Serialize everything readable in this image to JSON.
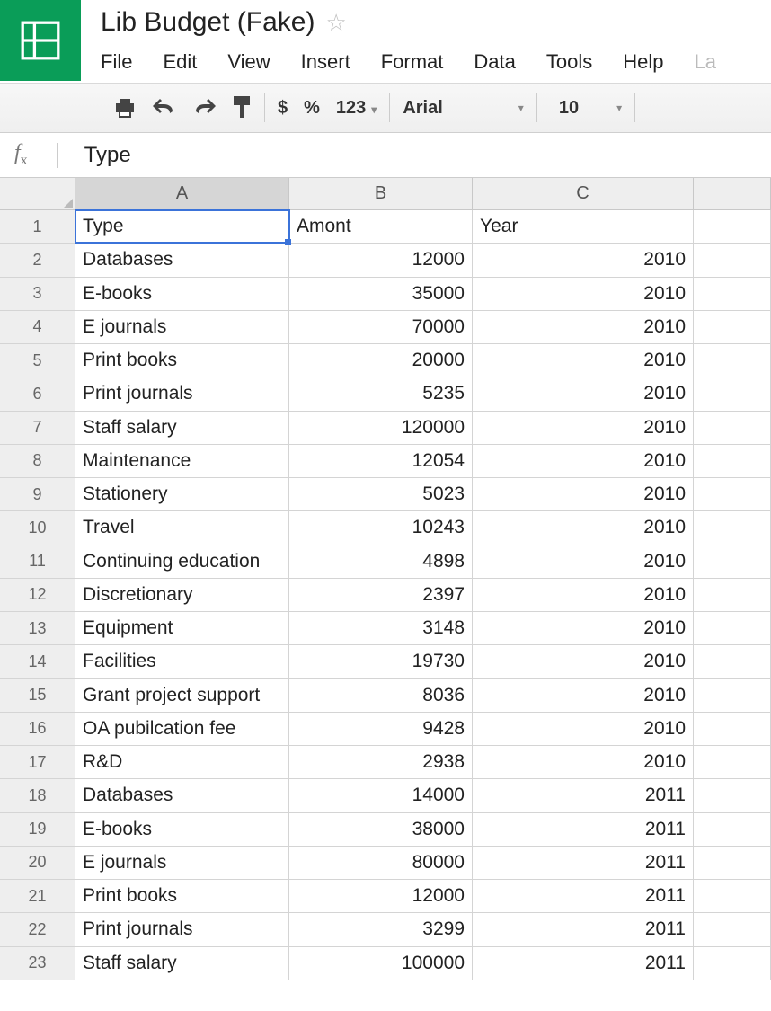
{
  "doc": {
    "title": "Lib Budget (Fake)"
  },
  "menu": {
    "file": "File",
    "edit": "Edit",
    "view": "View",
    "insert": "Insert",
    "format": "Format",
    "data": "Data",
    "tools": "Tools",
    "help": "Help",
    "last": "La"
  },
  "toolbar": {
    "dollar": "$",
    "percent": "%",
    "numfmt": "123",
    "font": "Arial",
    "size": "10"
  },
  "formula": {
    "label_f": "f",
    "label_x": "x",
    "value": "Type"
  },
  "columns": {
    "A": "A",
    "B": "B",
    "C": "C"
  },
  "header_row": {
    "A": "Type",
    "B": "Amont",
    "C": "Year"
  },
  "rows": [
    {
      "n": "2",
      "a": "Databases",
      "b": "12000",
      "c": "2010"
    },
    {
      "n": "3",
      "a": "E-books",
      "b": "35000",
      "c": "2010"
    },
    {
      "n": "4",
      "a": "E journals",
      "b": "70000",
      "c": "2010"
    },
    {
      "n": "5",
      "a": "Print books",
      "b": "20000",
      "c": "2010"
    },
    {
      "n": "6",
      "a": "Print journals",
      "b": "5235",
      "c": "2010"
    },
    {
      "n": "7",
      "a": "Staff salary",
      "b": "120000",
      "c": "2010"
    },
    {
      "n": "8",
      "a": "Maintenance",
      "b": "12054",
      "c": "2010"
    },
    {
      "n": "9",
      "a": "Stationery",
      "b": "5023",
      "c": "2010"
    },
    {
      "n": "10",
      "a": "Travel",
      "b": "10243",
      "c": "2010"
    },
    {
      "n": "11",
      "a": "Continuing education",
      "b": "4898",
      "c": "2010"
    },
    {
      "n": "12",
      "a": "Discretionary",
      "b": "2397",
      "c": "2010"
    },
    {
      "n": "13",
      "a": "Equipment",
      "b": "3148",
      "c": "2010"
    },
    {
      "n": "14",
      "a": "Facilities",
      "b": "19730",
      "c": "2010"
    },
    {
      "n": "15",
      "a": "Grant project support",
      "b": "8036",
      "c": "2010"
    },
    {
      "n": "16",
      "a": "OA pubilcation fee",
      "b": "9428",
      "c": "2010"
    },
    {
      "n": "17",
      "a": "R&D",
      "b": "2938",
      "c": "2010"
    },
    {
      "n": "18",
      "a": "Databases",
      "b": "14000",
      "c": "2011"
    },
    {
      "n": "19",
      "a": "E-books",
      "b": "38000",
      "c": "2011"
    },
    {
      "n": "20",
      "a": "E journals",
      "b": "80000",
      "c": "2011"
    },
    {
      "n": "21",
      "a": "Print books",
      "b": "12000",
      "c": "2011"
    },
    {
      "n": "22",
      "a": "Print journals",
      "b": "3299",
      "c": "2011"
    },
    {
      "n": "23",
      "a": "Staff salary",
      "b": "100000",
      "c": "2011"
    }
  ]
}
